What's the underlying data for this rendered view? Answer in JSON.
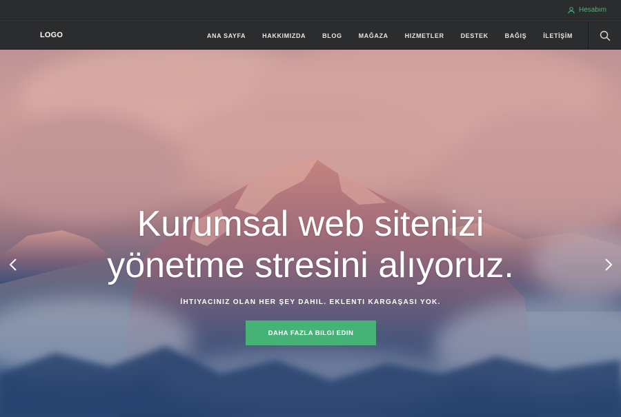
{
  "header": {
    "account_label": "Hesabım",
    "logo": "LOGO",
    "nav": [
      {
        "label": "ANA SAYFA"
      },
      {
        "label": "HAKKIMIZDA"
      },
      {
        "label": "BLOG"
      },
      {
        "label": "MAĞAZA"
      },
      {
        "label": "HIZMETLER"
      },
      {
        "label": "DESTEK"
      },
      {
        "label": "BAĞIŞ"
      },
      {
        "label": "İLETİŞİM"
      }
    ],
    "search_icon": "search-icon",
    "account_icon": "user-icon"
  },
  "hero": {
    "headline_line1": "Kurumsal web sitenizi",
    "headline_line2": "yönetme stresini alıyoruz.",
    "subtitle": "İHTIYACINIZ OLAN HER ŞEY DAHIL. EKLENTI KARGAŞASI YOK.",
    "cta_label": "DAHA FAZLA BILGI EDIN",
    "prev_icon": "chevron-left-icon",
    "next_icon": "chevron-right-icon"
  },
  "colors": {
    "accent": "#46b277",
    "nav_background": "#2b2c2e",
    "account_text": "#4cb77a"
  }
}
